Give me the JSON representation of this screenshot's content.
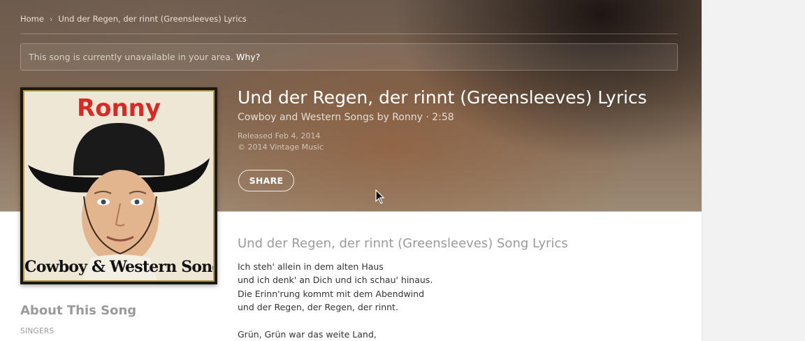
{
  "breadcrumb": {
    "home": "Home",
    "separator": "›",
    "current": "Und der Regen, der rinnt (Greensleeves) Lyrics"
  },
  "notice": {
    "text": "This song is currently unavailable in your area.",
    "link": "Why?"
  },
  "album": {
    "cover_top_text": "Ronny",
    "cover_bottom_text": "Cowboy & Western Songs"
  },
  "song": {
    "title": "Und der Regen, der rinnt (Greensleeves) Lyrics",
    "subtitle": "Cowboy and Western Songs by Ronny · 2:58",
    "released": "Released Feb 4, 2014",
    "copyright": "© 2014 Vintage Music",
    "share_label": "SHARE"
  },
  "lyrics": {
    "heading": "Und der Regen, der rinnt (Greensleeves) Song Lyrics",
    "lines": [
      "Ich steh' allein in dem alten Haus",
      "und ich denk' an Dich und ich schau' hinaus.",
      "Die Erinn'rung kommt mit dem Abendwind",
      "und der Regen, der Regen, der rinnt.",
      "",
      "Grün, Grün war das weite Land,"
    ]
  },
  "about": {
    "heading": "About This Song",
    "singers_label": "SINGERS"
  },
  "icons": {
    "breadcrumb_separator": "chevron-right-icon",
    "cursor": "mouse-pointer-icon"
  }
}
